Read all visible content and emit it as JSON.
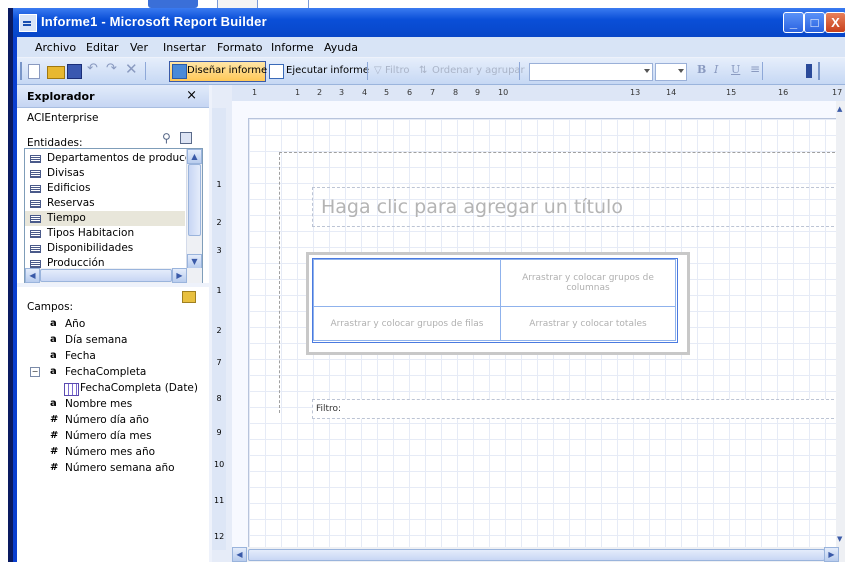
{
  "window": {
    "title": "Informe1 - Microsoft Report Builder",
    "buttons": [
      "_",
      "□",
      "X"
    ]
  },
  "menu": [
    "Archivo",
    "Editar",
    "Ver",
    "Insertar",
    "Formato",
    "Informe",
    "Ayuda"
  ],
  "toolbar": {
    "design_label": "Diseñar informe",
    "run_label": "Ejecutar informe",
    "filter_label": "Filtro",
    "sort_label": "Ordenar y agrupar",
    "bold": "B",
    "italic": "I",
    "underline": "U"
  },
  "explorer": {
    "title": "Explorador",
    "close": "×",
    "model": "ACIEnterprise",
    "entities_label": "Entidades:",
    "entities": [
      "Departamentos de producción",
      "Divisas",
      "Edificios",
      "Reservas",
      "Tiempo",
      "Tipos Habitacion",
      "Disponibilidades",
      "Producción"
    ],
    "selected_entity": "Tiempo",
    "fields_label": "Campos:",
    "fields": [
      {
        "type": "a",
        "name": "Año"
      },
      {
        "type": "a",
        "name": "Día semana"
      },
      {
        "type": "a",
        "name": "Fecha"
      },
      {
        "type": "a",
        "name": "FechaCompleta"
      },
      {
        "type": "",
        "name": "FechaCompleta (Date)"
      },
      {
        "type": "a",
        "name": "Nombre mes"
      },
      {
        "type": "#",
        "name": "Número día año"
      },
      {
        "type": "#",
        "name": "Número día mes"
      },
      {
        "type": "#",
        "name": "Número mes año"
      },
      {
        "type": "#",
        "name": "Número semana año"
      }
    ]
  },
  "ruler": {
    "h_marks": [
      "1",
      "1",
      "2",
      "3",
      "4",
      "5",
      "6",
      "7",
      "8",
      "9",
      "10",
      "13",
      "14",
      "15",
      "16",
      "17"
    ],
    "v_marks": [
      "1",
      "2",
      "3",
      "1",
      "2",
      "7",
      "8",
      "9",
      "10",
      "11",
      "12"
    ]
  },
  "report": {
    "title_placeholder": "Haga clic para agregar un título",
    "column_groups": "Arrastrar y colocar grupos de columnas",
    "row_groups": "Arrastrar y colocar grupos de filas",
    "totals": "Arrastrar y colocar totales",
    "filter_label": "Filtro:"
  }
}
